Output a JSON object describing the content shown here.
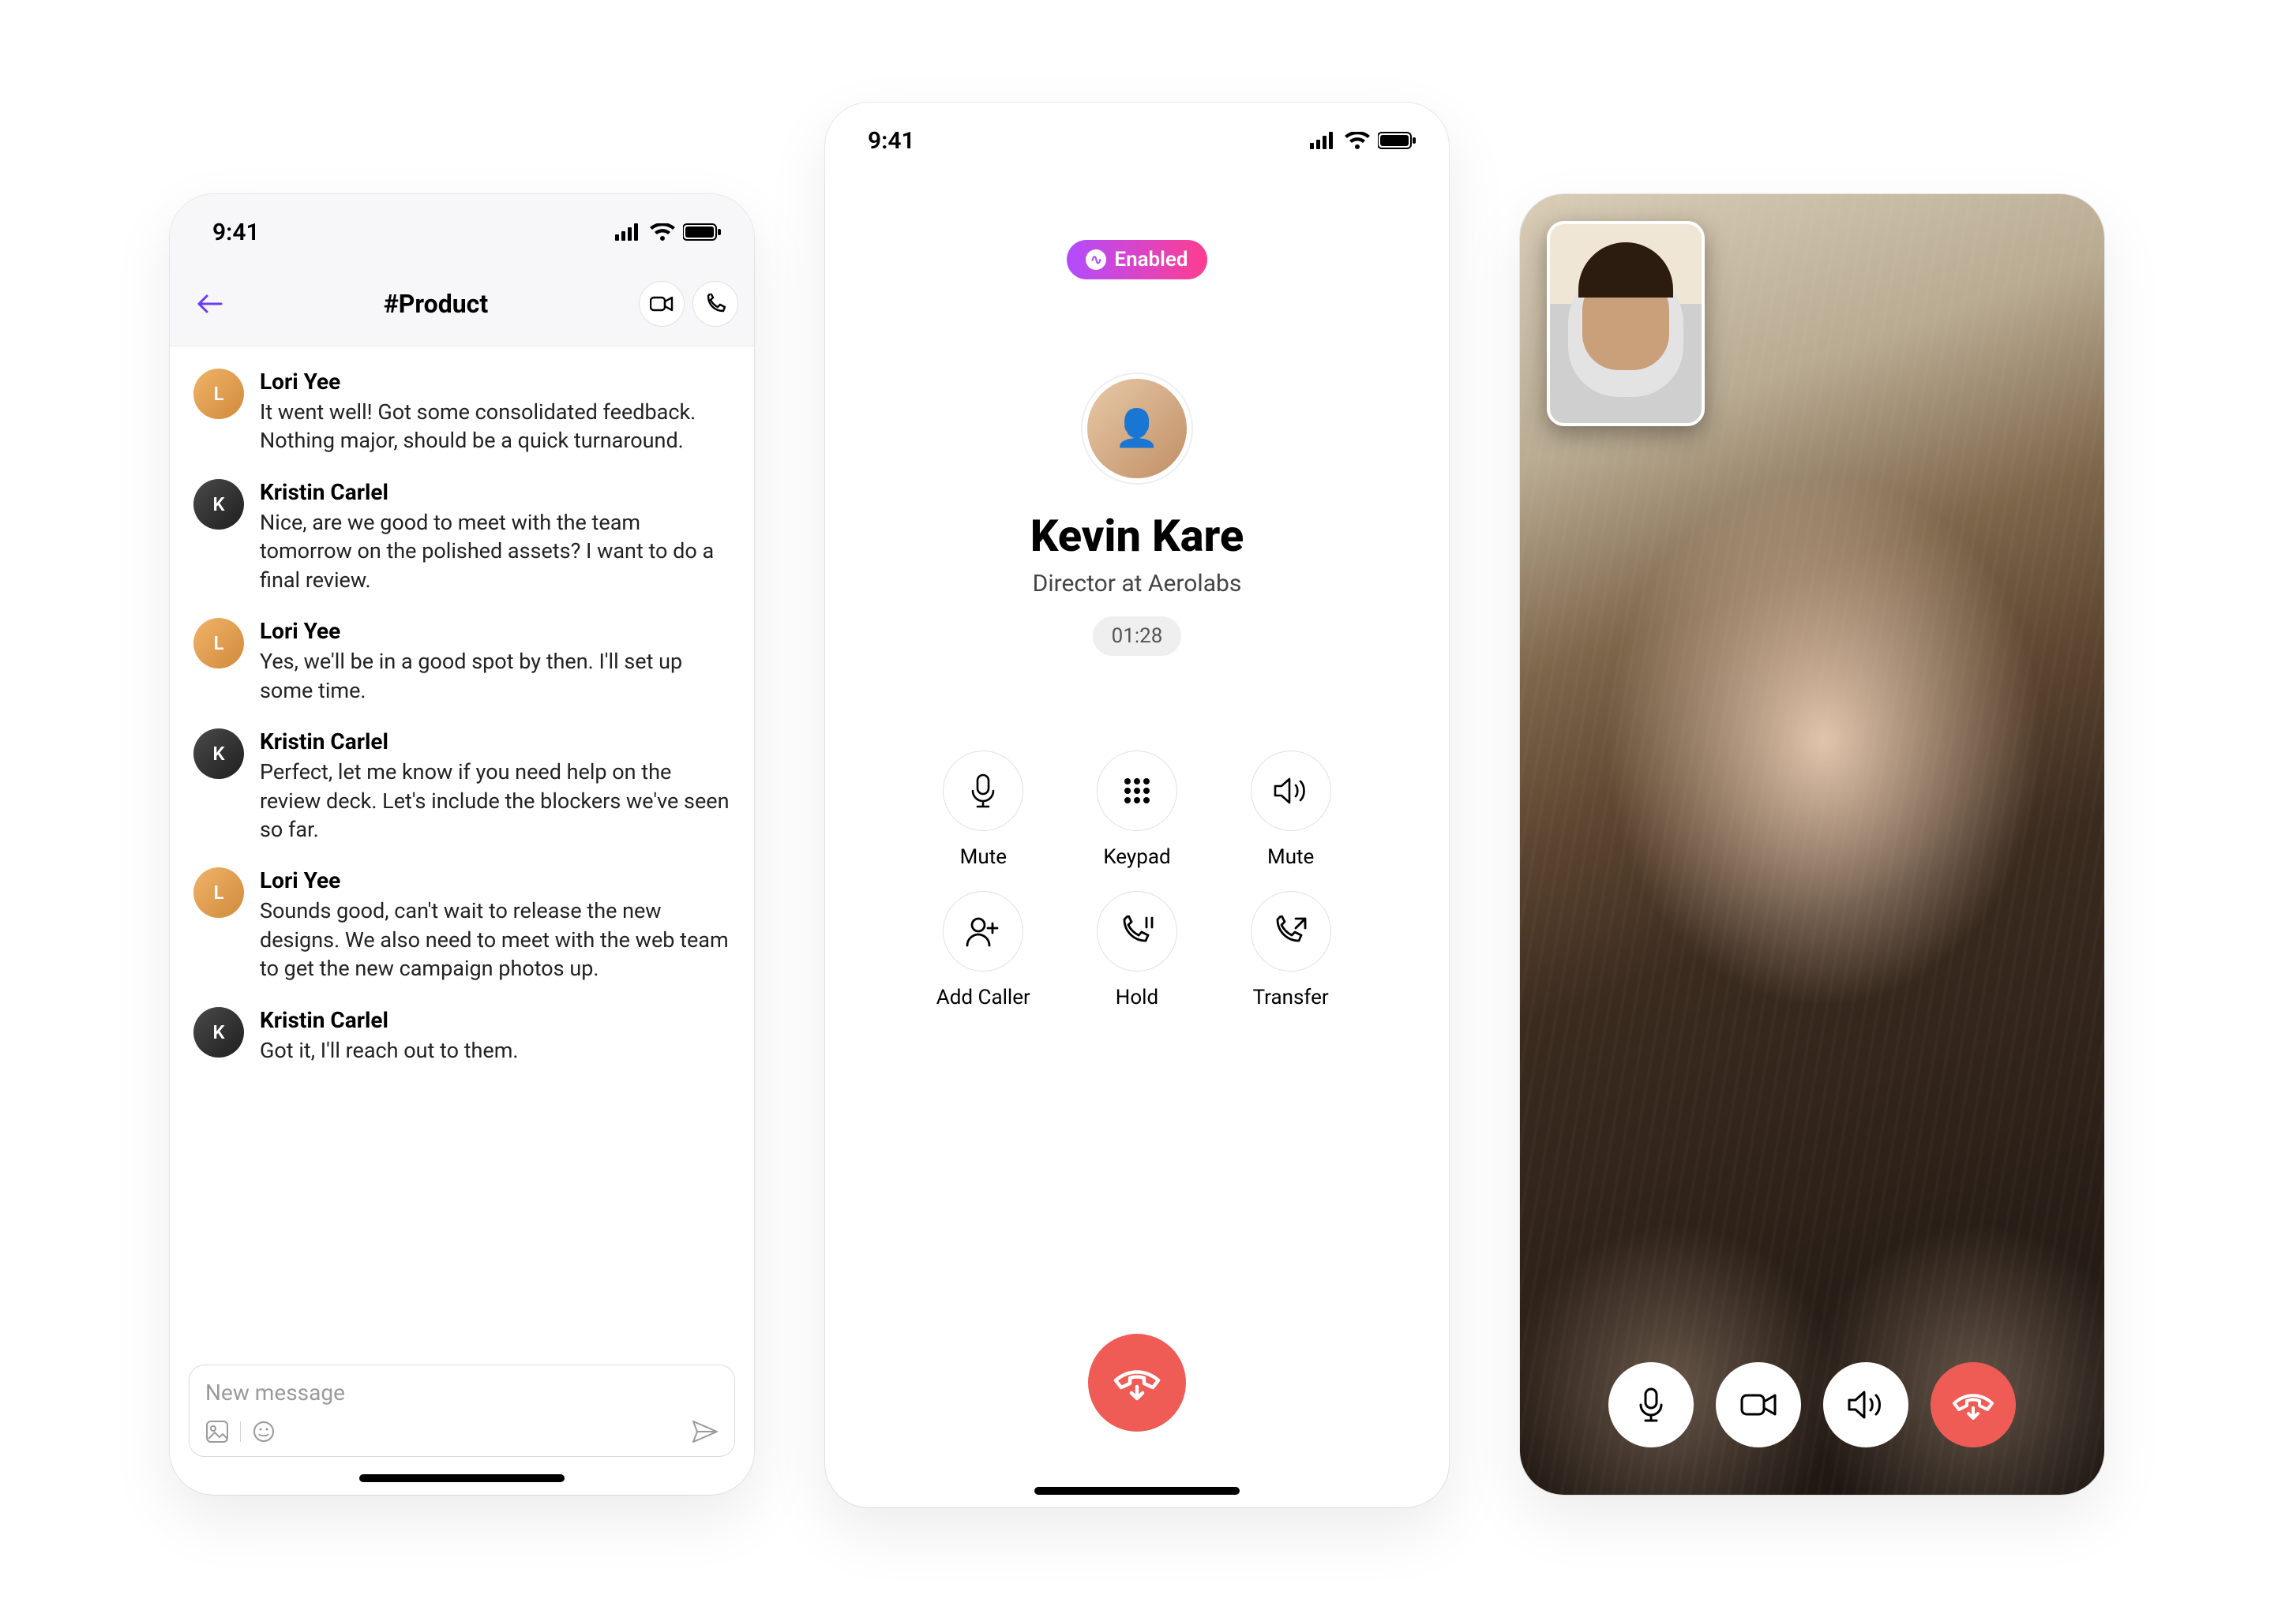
{
  "statusbar": {
    "time": "9:41"
  },
  "chat": {
    "channel": "#Product",
    "compose_placeholder": "New message",
    "messages": [
      {
        "author": "Lori Yee",
        "text": "It went well! Got some consolidated feedback. Nothing major, should be a quick turnaround."
      },
      {
        "author": "Kristin Carlel",
        "text": "Nice, are we good to meet with the team tomorrow on the polished assets? I want to do a final review."
      },
      {
        "author": "Lori Yee",
        "text": "Yes, we'll be in a good spot by then. I'll set up some time."
      },
      {
        "author": "Kristin Carlel",
        "text": "Perfect, let me know if you need help on the review deck. Let's include the blockers we've seen so far."
      },
      {
        "author": "Lori Yee",
        "text": "Sounds good, can't wait to release the new designs. We also need to meet with the web team to get the new campaign photos up."
      },
      {
        "author": "Kristin Carlel",
        "text": "Got it, I'll reach out to them."
      }
    ]
  },
  "call": {
    "enabled_label": "Enabled",
    "name": "Kevin Kare",
    "subtitle": "Director at Aerolabs",
    "timer": "01:28",
    "controls": [
      {
        "id": "mute",
        "label": "Mute"
      },
      {
        "id": "keypad",
        "label": "Keypad"
      },
      {
        "id": "speaker",
        "label": "Mute"
      },
      {
        "id": "add-caller",
        "label": "Add Caller"
      },
      {
        "id": "hold",
        "label": "Hold"
      },
      {
        "id": "transfer",
        "label": "Transfer"
      }
    ]
  },
  "colors": {
    "accent_purple": "#6c3bff",
    "hangup_red": "#ef5c55",
    "pill_gradient_from": "#b24cff",
    "pill_gradient_to": "#ff3d8f"
  }
}
